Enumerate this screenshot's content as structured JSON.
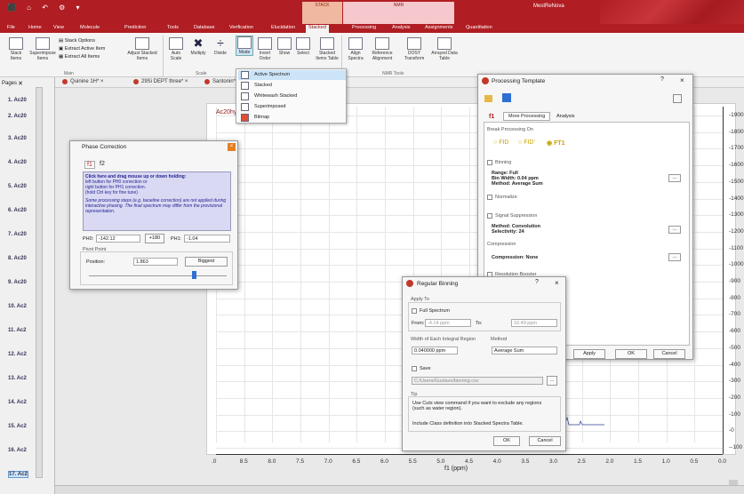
{
  "app": {
    "title": "MestReNova",
    "quick_access": "⬛ ⌂ ↶ ⚙ ▾"
  },
  "context_tabs": {
    "stack_group": "STACK",
    "nmr_group": "NMR"
  },
  "ribbon_tabs": [
    "File",
    "Home",
    "View",
    "Molecule",
    "Prediction",
    "Tools",
    "Database",
    "Verification",
    "Elucidation",
    "Stacked",
    "Processing",
    "Analysis",
    "Assignments",
    "Quantitation"
  ],
  "ribbon": {
    "stack_items": "Stack Items",
    "superimpose_items": "Superimpose Items",
    "stack_options": "Stack Options",
    "extract_active": "Extract Active Item",
    "extract_all": "Extract All Items",
    "adjust_stacked": "Adjust Stacked Items",
    "auto_scale": "Auto Scale",
    "multiply": "Multiply",
    "divide": "Divide",
    "mode": "Mode",
    "invert_order": "Invert Order",
    "show": "Show",
    "select": "Select",
    "stacked_items_table": "Stacked Items Table",
    "align_spectra": "Align Spectra",
    "reference_alignment": "Reference Alignment",
    "dosy_transform": "DOSY Transform",
    "arrayed_data_table": "Arrayed Data Table",
    "group_main": "Main",
    "group_scale": "Scale",
    "group_nmr_tools": "NMR Tools"
  },
  "mode_menu": [
    "Active Spectrum",
    "Stacked",
    "Whitewash Stacked",
    "Superimposed",
    "Bitmap"
  ],
  "pages": {
    "header": "Pages",
    "items": [
      "1. Ac20",
      "2. Ac20",
      "3. Ac20",
      "4. Ac20",
      "5. Ac20",
      "6. Ac20",
      "7. Ac20",
      "8. Ac20",
      "9. Ac20",
      "10. Ac2",
      "11. Ac2",
      "12. Ac2",
      "13. Ac2",
      "14. Ac2",
      "15. Ac2",
      "16. Ac2",
      "17. Ac2"
    ]
  },
  "doc_tabs": [
    "Quinine 1H*",
    "29Si DEPT three*",
    "Santonin*"
  ],
  "plot": {
    "spectrum_label": "Ac20hyd",
    "xlabel": "f1 (ppm)",
    "x_ticks": [
      ".0",
      "8.5",
      "8.0",
      "7.5",
      "7.0",
      "6.5",
      "6.0",
      "5.5",
      "5.0",
      "4.5",
      "4.0",
      "3.5",
      "3.0",
      "2.5",
      "2.0",
      "1.5",
      "1.0",
      "0.5",
      "0.0"
    ],
    "y_ticks": [
      "-1900",
      "-1800",
      "-1700",
      "-1600",
      "-1500",
      "-1400",
      "-1300",
      "-1200",
      "-1100",
      "-1000",
      "-900",
      "-800",
      "-700",
      "-600",
      "-500",
      "-400",
      "-300",
      "-200",
      "-100",
      "-0",
      "--100"
    ]
  },
  "phase_dialog": {
    "title": "Phase Correction",
    "tab1": "f1",
    "tab2": "f2",
    "info_title": "Click here and drag mouse up or down holding:",
    "info_left": "left button for PH0 correction or",
    "info_right": "right button for PH1 correction.",
    "info_ctrl": "(hold Ctrl key for fine tune)",
    "info_note": "Some processing steps (e.g. baseline correction) are not applied during interactive phasing. The final spectrum may differ from the provisional representation.",
    "ph0_label": "PH0:",
    "ph0_value": "-142.12",
    "ph180": "+180",
    "ph1_label": "PH1:",
    "ph1_value": "-1.04",
    "pivot_section": "Pivot Point",
    "position_label": "Position:",
    "position_value": "1.863",
    "biggest": "Biggest"
  },
  "proc_template": {
    "title": "Processing Template",
    "tab_f1": "f1",
    "tab_more": "More Processing",
    "tab_analysis": "Analysis",
    "break_section": "Break Processing On",
    "fid": "FID",
    "fid2": "FID'",
    "ft1": "FT1",
    "binning": "Binning",
    "range": "Range: Full",
    "bin_width": "Bin Width: 0.04 ppm",
    "method": "Method: Average Sum",
    "normalize": "Normalize",
    "signal_suppression": "Signal Suppression",
    "ss_method": "Method: Convolution",
    "ss_selectivity": "Selectivity: 24",
    "compression_section": "Compression",
    "compression": "Compression: None",
    "resolution_booster": "Resolution Booster",
    "apply": "Apply",
    "ok": "OK",
    "cancel": "Cancel"
  },
  "binning_dialog": {
    "title": "Regular Binning",
    "apply_to": "Apply To",
    "full_spectrum": "Full Spectrum",
    "from_label": "From:",
    "from_value": "-4.14 ppm",
    "to_label": "To:",
    "to_value": "16.49 ppm",
    "width_section": "Width of Each Integral Region",
    "width_value": "0.040000 ppm",
    "method_section": "Method",
    "method_value": "Average Sum",
    "save": "Save",
    "save_path": "C:/Users/Gustavo/binning.csv",
    "browse": "...",
    "tip_section": "Tip",
    "tip1": "Use Cuts view command if you want to exclude any regions (such as water region).",
    "tip2": "Include Class definition into Stacked Spectra Table.",
    "ok": "OK",
    "cancel": "Cancel"
  },
  "colors": {
    "brand": "#b01d22",
    "info_bg": "#d9d9f4",
    "info_text": "#24248f"
  }
}
